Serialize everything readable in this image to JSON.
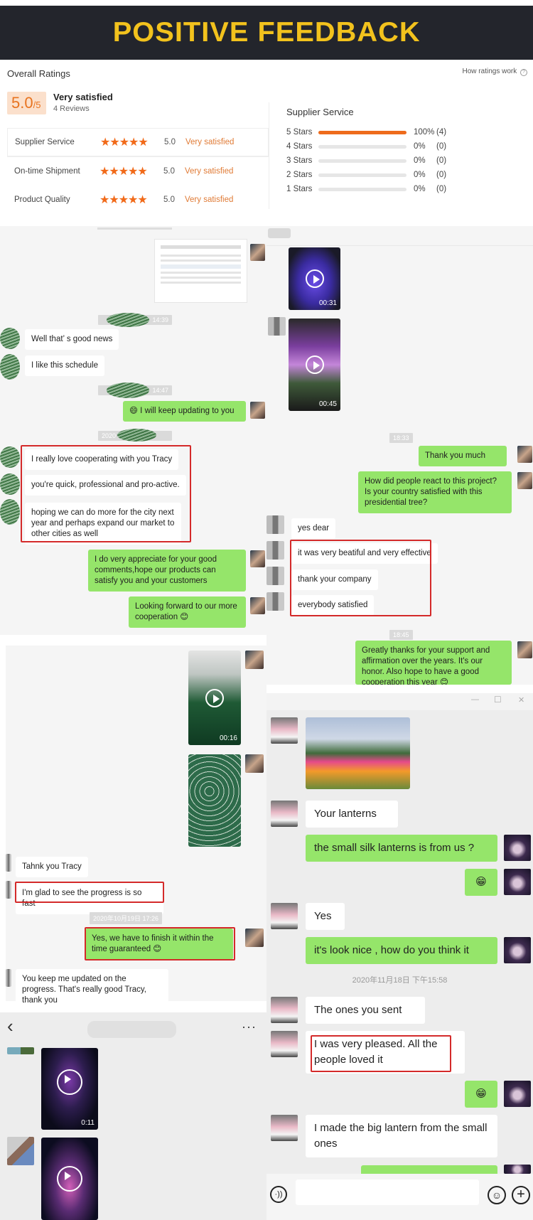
{
  "banner": {
    "title": "POSITIVE FEEDBACK"
  },
  "ratings": {
    "overall_title": "Overall Ratings",
    "how_link": "How ratings work",
    "score": "5.0",
    "score_max": "/5",
    "summary": "Very satisfied",
    "reviews": "4 Reviews",
    "categories": [
      {
        "label": "Supplier Service",
        "stars": 5,
        "score": "5.0",
        "verdict": "Very satisfied"
      },
      {
        "label": "On-time Shipment",
        "stars": 5,
        "score": "5.0",
        "verdict": "Very satisfied"
      },
      {
        "label": "Product Quality",
        "stars": 5,
        "score": "5.0",
        "verdict": "Very satisfied"
      }
    ],
    "breakdown_title": "Supplier Service",
    "breakdown": [
      {
        "label": "5 Stars",
        "percent": 100,
        "pct_text": "100%",
        "count": "(4)"
      },
      {
        "label": "4 Stars",
        "percent": 0,
        "pct_text": "0%",
        "count": "(0)"
      },
      {
        "label": "3 Stars",
        "percent": 0,
        "pct_text": "0%",
        "count": "(0)"
      },
      {
        "label": "2 Stars",
        "percent": 0,
        "pct_text": "0%",
        "count": "(0)"
      },
      {
        "label": "1 Stars",
        "percent": 0,
        "pct_text": "0%",
        "count": "(0)"
      }
    ],
    "accent": "#ee6b1c"
  },
  "chat1": {
    "ts1": "14:39",
    "m1": "Well that’ s good news",
    "m2": "I like this schedule",
    "ts2": "14:47",
    "m3": "😄 I will keep updating to you",
    "ts3": "2020",
    "m4": "I really love cooperating with you Tracy",
    "m5": "you're quick, professional and pro-active.",
    "m6": "hoping we can do more for the city next year and perhaps expand our market to other cities as well",
    "m7": "I do very appreciate for your good comments,hope our products can satisfy you and your customers",
    "m8": "Looking forward to our more cooperation 😊"
  },
  "chat2": {
    "v1_duration": "00:31",
    "v2_duration": "00:45",
    "ts1": "18:33",
    "m1": "Thank you much",
    "m2": "How did people react to this project? Is your country satisfied with this presidential tree?",
    "m3": "yes dear",
    "m4": "it was very beatiful and very effective",
    "m5": "thank your company",
    "m6": "everybody satisfied",
    "ts2": "18:45",
    "m7": "Greatly thanks for your support and affirmation over the years. It's our honor. Also hope to have a good cooperation this year 😊"
  },
  "chat3": {
    "v1_duration": "00:16",
    "m1": "Tahnk you Tracy",
    "m2": "I'm glad to see the progress is so fast",
    "ts1": "2020年10月19日 17:26",
    "m3": "Yes, we have to finish it within the time guaranteed 😊",
    "m4": "You keep me updated on the progress. That's really good Tracy, thank you"
  },
  "chat4": {
    "back": "‹",
    "more": "···",
    "v1_duration": "0:11"
  },
  "chat5": {
    "minimize": "—",
    "maximize": "☐",
    "close": "✕",
    "m1": "Your  lanterns",
    "m2": "the small silk lanterns is from us ?",
    "m3": "😁",
    "m4": "Yes",
    "m5": "it's look nice , how do you think it",
    "ts1": "2020年11月18日 下午15:58",
    "m6": "The ones  you  sent",
    "m7": "I was very  pleased.  All the people  loved it",
    "m8": "😁",
    "m9": "I made  the  big  lantern  from  the small  ones",
    "input_placeholder": ""
  }
}
